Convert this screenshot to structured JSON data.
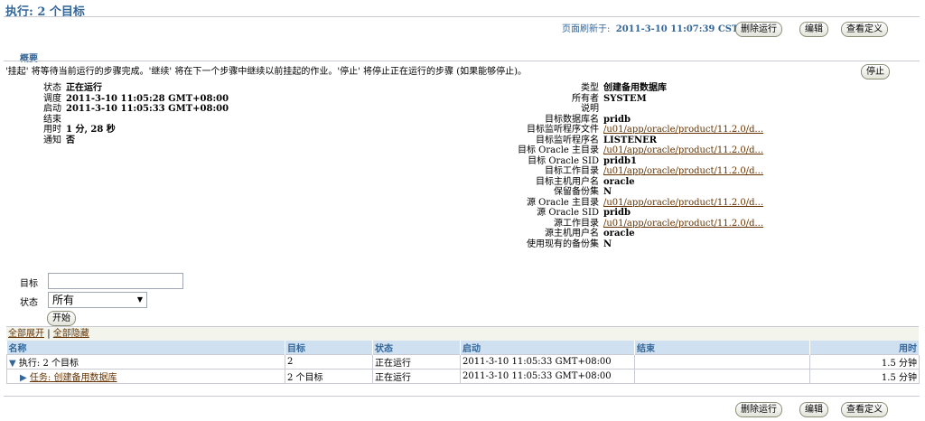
{
  "header": {
    "title": "执行: 2 个目标",
    "refresh_label": "页面刷新于:",
    "refresh_time": "2011-3-10 11:07:39 CST",
    "buttons": {
      "delete": "删除运行",
      "edit": "编辑",
      "view": "查看定义"
    }
  },
  "summary": {
    "title": "概要",
    "description": "'挂起' 将等待当前运行的步骤完成。'继续' 将在下一个步骤中继续以前挂起的作业。'停止' 将停止正在运行的步骤 (如果能够停止)。",
    "stop_label": "停止",
    "left": [
      {
        "k": "状态",
        "v": "正在运行"
      },
      {
        "k": "调度",
        "v": "2011-3-10 11:05:28 GMT+08:00"
      },
      {
        "k": "启动",
        "v": "2011-3-10 11:05:33 GMT+08:00"
      },
      {
        "k": "结束",
        "v": ""
      },
      {
        "k": "用时",
        "v": "1 分, 28 秒"
      },
      {
        "k": "通知",
        "v": "否"
      }
    ],
    "right": [
      {
        "k": "类型",
        "v": "创建备用数据库",
        "link": false
      },
      {
        "k": "所有者",
        "v": "SYSTEM",
        "link": false
      },
      {
        "k": "说明",
        "v": "",
        "link": false
      },
      {
        "k": "目标数据库名",
        "v": "pridb",
        "link": false
      },
      {
        "k": "目标监听程序文件",
        "v": "/u01/app/oracle/product/11.2.0/d...",
        "link": true
      },
      {
        "k": "目标监听程序名",
        "v": "LISTENER",
        "link": false
      },
      {
        "k": "目标 Oracle 主目录",
        "v": "/u01/app/oracle/product/11.2.0/d...",
        "link": true
      },
      {
        "k": "目标 Oracle SID",
        "v": "pridb1",
        "link": false
      },
      {
        "k": "目标工作目录",
        "v": "/u01/app/oracle/product/11.2.0/d...",
        "link": true
      },
      {
        "k": "目标主机用户名",
        "v": "oracle",
        "link": false
      },
      {
        "k": "保留备份集",
        "v": "N",
        "link": false
      },
      {
        "k": "源 Oracle 主目录",
        "v": "/u01/app/oracle/product/11.2.0/d...",
        "link": true
      },
      {
        "k": "源 Oracle SID",
        "v": "pridb",
        "link": false
      },
      {
        "k": "源工作目录",
        "v": "/u01/app/oracle/product/11.2.0/d...",
        "link": true
      },
      {
        "k": "源主机用户名",
        "v": "oracle",
        "link": false
      },
      {
        "k": "使用现有的备份集",
        "v": "N",
        "link": false
      }
    ]
  },
  "filter": {
    "target_label": "目标",
    "target_value": "",
    "status_label": "状态",
    "status_value": "所有",
    "go_label": "开始"
  },
  "table": {
    "expand_all": "全部展开",
    "separator": "|",
    "collapse_all": "全部隐藏",
    "headers": {
      "name": "名称",
      "target": "目标",
      "status": "状态",
      "start": "启动",
      "end": "结束",
      "elapsed": "用时"
    },
    "rows": [
      {
        "name": "执行: 2 个目标",
        "target": "2",
        "status": "正在运行",
        "start": "2011-3-10 11:05:33 GMT+08:00",
        "end": "",
        "elapsed": "1.5 分钟",
        "link": false
      },
      {
        "name": "任务: 创建备用数据库",
        "target": "2 个目标",
        "status": "正在运行",
        "start": "2011-3-10 11:05:33 GMT+08:00",
        "end": "",
        "elapsed": "1.5 分钟",
        "link": true
      }
    ]
  },
  "icons": {
    "expanded": "triangle-down-icon",
    "collapsed": "triangle-right-icon",
    "dropdown": "chevron-down-icon"
  },
  "colors": {
    "header_text": "#336699",
    "link": "#663300",
    "table_header_bg": "#cfe0f1"
  }
}
